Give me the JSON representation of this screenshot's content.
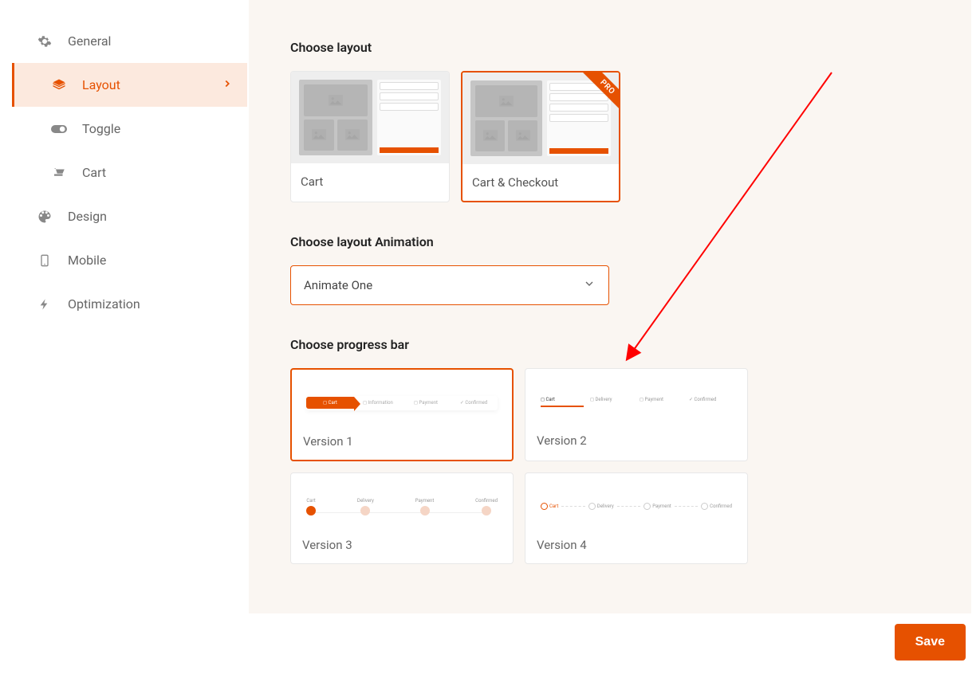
{
  "sidebar": {
    "general": "General",
    "layout": "Layout",
    "toggle": "Toggle",
    "cart": "Cart",
    "design": "Design",
    "mobile": "Mobile",
    "optimization": "Optimization"
  },
  "sections": {
    "choose_layout": "Choose layout",
    "choose_animation": "Choose layout Animation",
    "choose_progress": "Choose progress bar"
  },
  "layout_cards": {
    "cart": "Cart",
    "cart_checkout": "Cart & Checkout",
    "pro": "PRO"
  },
  "animation_select": {
    "value": "Animate One"
  },
  "progress": {
    "v1": "Version 1",
    "v2": "Version 2",
    "v3": "Version 3",
    "v4": "Version 4",
    "steps": {
      "cart": "Cart",
      "information": "Information",
      "delivery": "Delivery",
      "payment": "Payment",
      "confirmed": "Confirmed"
    }
  },
  "buttons": {
    "save": "Save"
  },
  "colors": {
    "accent": "#e65100"
  }
}
